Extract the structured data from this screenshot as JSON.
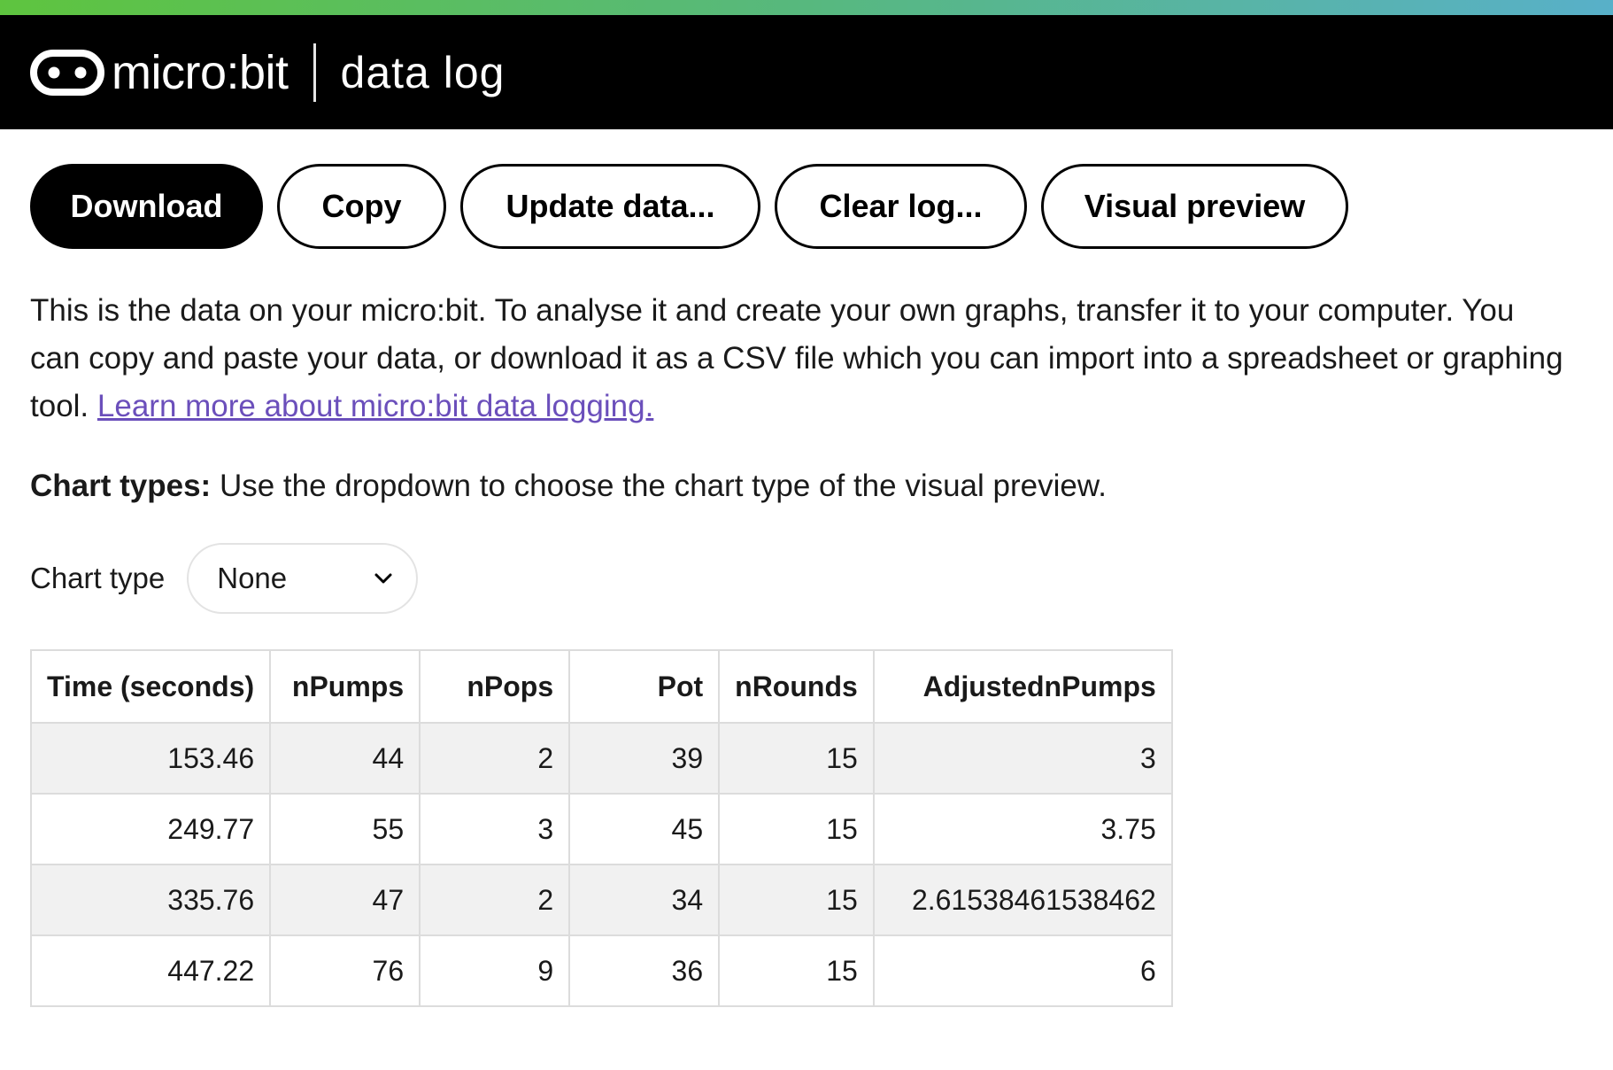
{
  "header": {
    "brand": "micro:bit",
    "app_name": "data log",
    "logo_icon": "microbit-logo-icon"
  },
  "toolbar": {
    "download_label": "Download",
    "copy_label": "Copy",
    "update_label": "Update data...",
    "clear_label": "Clear log...",
    "preview_label": "Visual preview"
  },
  "intro": {
    "text": "This is the data on your micro:bit. To analyse it and create your own graphs, transfer it to your computer. You can copy and paste your data, or download it as a CSV file which you can import into a spreadsheet or graphing tool. ",
    "link_text": "Learn more about micro:bit data logging."
  },
  "chart_types": {
    "heading": "Chart types:",
    "text": " Use the dropdown to choose the chart type of the visual preview."
  },
  "chart_type_select": {
    "label": "Chart type",
    "value": "None",
    "icon": "chevron-down-icon"
  },
  "table": {
    "headers": [
      "Time (seconds)",
      "nPumps",
      "nPops",
      "Pot",
      "nRounds",
      "AdjustednPumps"
    ],
    "rows": [
      [
        "153.46",
        "44",
        "2",
        "39",
        "15",
        "3"
      ],
      [
        "249.77",
        "55",
        "3",
        "45",
        "15",
        "3.75"
      ],
      [
        "335.76",
        "47",
        "2",
        "34",
        "15",
        "2.61538461538462"
      ],
      [
        "447.22",
        "76",
        "9",
        "36",
        "15",
        "6"
      ]
    ]
  },
  "colors": {
    "header_bg": "#000000",
    "link": "#6b4fbb",
    "gradient_start": "#5ec43f",
    "gradient_end": "#58b0c9",
    "row_stripe": "#f1f1f1"
  }
}
